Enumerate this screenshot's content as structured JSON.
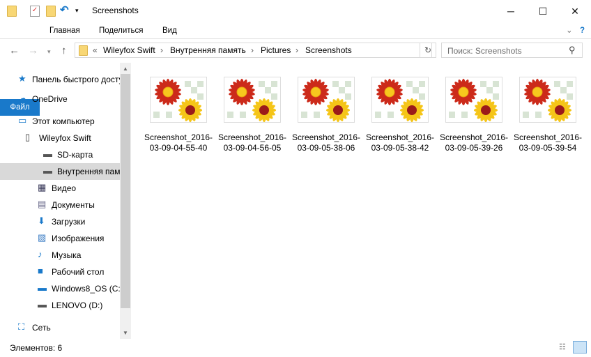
{
  "window": {
    "title": "Screenshots",
    "minimize": "─",
    "maximize": "☐",
    "close": "✕"
  },
  "ribbon": {
    "tabs": [
      "Файл",
      "Главная",
      "Поделиться",
      "Вид"
    ],
    "expand": "⌄",
    "help": "?"
  },
  "address": {
    "prefix": "«",
    "crumbs": [
      "Wileyfox Swift",
      "Внутренняя память",
      "Pictures",
      "Screenshots"
    ],
    "separator": "›"
  },
  "search": {
    "placeholder": "Поиск: Screenshots"
  },
  "sidebar": {
    "items": [
      {
        "label": "Панель быстрого доступа",
        "icon": "star-icon"
      },
      {
        "label": "OneDrive",
        "icon": "cloud-icon"
      },
      {
        "label": "Этот компьютер",
        "icon": "computer-icon"
      },
      {
        "label": "Wileyfox Swift",
        "icon": "phone-icon"
      },
      {
        "label": "SD-карта",
        "icon": "drive-icon"
      },
      {
        "label": "Внутренняя память",
        "icon": "drive-icon",
        "selected": true
      },
      {
        "label": "Видео",
        "icon": "video-icon"
      },
      {
        "label": "Документы",
        "icon": "documents-icon"
      },
      {
        "label": "Загрузки",
        "icon": "download-icon"
      },
      {
        "label": "Изображения",
        "icon": "pictures-icon"
      },
      {
        "label": "Музыка",
        "icon": "music-icon"
      },
      {
        "label": "Рабочий стол",
        "icon": "desktop-icon"
      },
      {
        "label": "Windows8_OS (C:)",
        "icon": "windows-drive-icon"
      },
      {
        "label": "LENOVO (D:)",
        "icon": "drive-icon"
      },
      {
        "label": "Сеть",
        "icon": "network-icon"
      }
    ]
  },
  "files": [
    {
      "line1": "Screenshot_2016-",
      "line2": "03-09-04-55-40"
    },
    {
      "line1": "Screenshot_2016-",
      "line2": "03-09-04-56-05"
    },
    {
      "line1": "Screenshot_2016-",
      "line2": "03-09-05-38-06"
    },
    {
      "line1": "Screenshot_2016-",
      "line2": "03-09-05-38-42"
    },
    {
      "line1": "Screenshot_2016-",
      "line2": "03-09-05-39-26"
    },
    {
      "line1": "Screenshot_2016-",
      "line2": "03-09-05-39-54"
    }
  ],
  "status": {
    "items": "Элементов: 6"
  },
  "colors": {
    "accent": "#1979ca",
    "selected": "#d9d9d9"
  }
}
